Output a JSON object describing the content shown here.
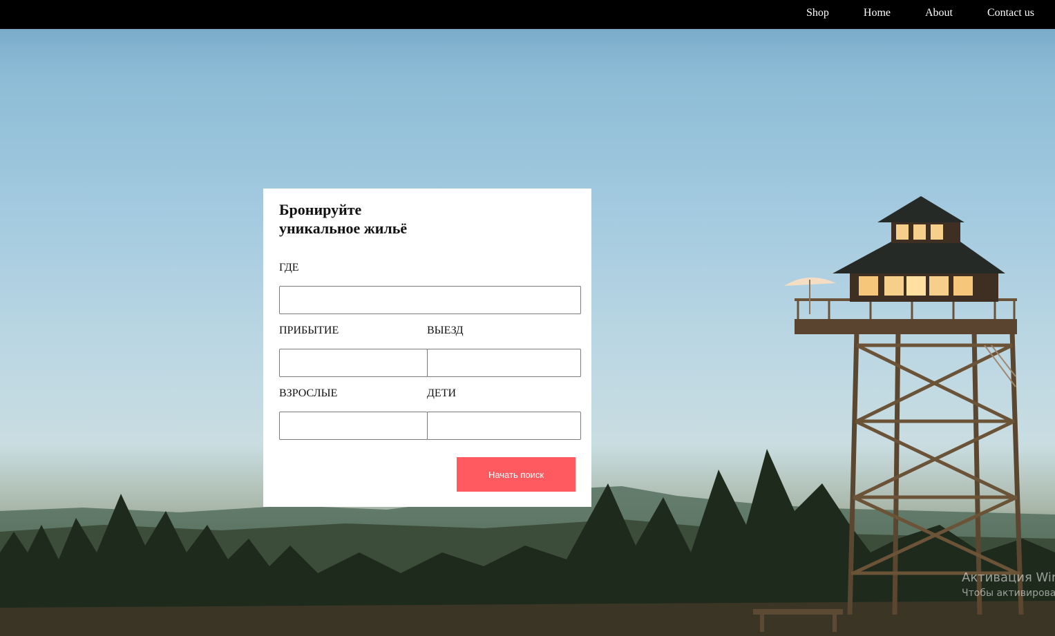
{
  "nav": {
    "items": [
      "Shop",
      "Home",
      "About",
      "Contact us"
    ]
  },
  "booking": {
    "title_line1": "Бронируйте",
    "title_line2": "уникальное жильё",
    "where_label": "ГДЕ",
    "arrival_label": "ПРИБЫТИЕ",
    "departure_label": "ВЫЕЗД",
    "adults_label": "ВЗРОСЛЫЕ",
    "children_label": "ДЕТИ",
    "where_value": "",
    "arrival_value": "",
    "departure_value": "",
    "adults_value": "",
    "children_value": "",
    "search_button": "Начать поиск"
  },
  "watermark": {
    "line1": "Активация Wir",
    "line2": "Чтобы активироват"
  },
  "colors": {
    "nav_bg": "#000000",
    "button_bg": "#ff5a5f",
    "card_bg": "#ffffff"
  }
}
